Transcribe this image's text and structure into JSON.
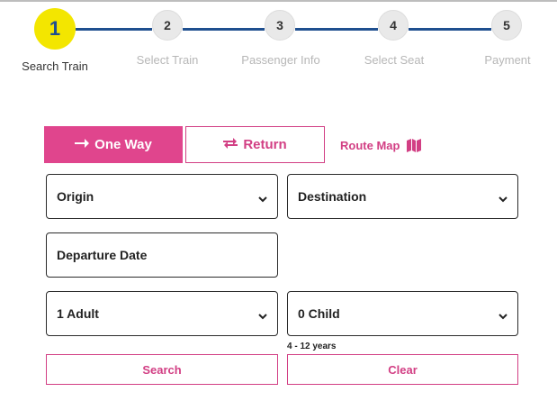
{
  "stepper": {
    "steps": [
      {
        "number": "1",
        "label": "Search Train",
        "active": true
      },
      {
        "number": "2",
        "label": "Select Train",
        "active": false
      },
      {
        "number": "3",
        "label": "Passenger Info",
        "active": false
      },
      {
        "number": "4",
        "label": "Select Seat",
        "active": false
      },
      {
        "number": "5",
        "label": "Payment",
        "active": false
      }
    ],
    "active_color": "#f3e600",
    "line_color": "#1f4f8f"
  },
  "trip_type": {
    "one_way_label": "One Way",
    "one_way_icon": "arrow-right-icon",
    "return_label": "Return",
    "return_icon": "swap-arrows-icon",
    "selected": "One Way"
  },
  "route_map": {
    "label": "Route Map",
    "icon": "map-icon"
  },
  "form": {
    "origin": "Origin",
    "destination": "Destination",
    "departure_date": "Departure Date",
    "adults": "1 Adult",
    "children": "0 Child",
    "child_note": "4 - 12 years"
  },
  "actions": {
    "search_label": "Search",
    "clear_label": "Clear"
  },
  "colors": {
    "brand_pink": "#e0458d",
    "accent_pink": "#d23f84"
  }
}
